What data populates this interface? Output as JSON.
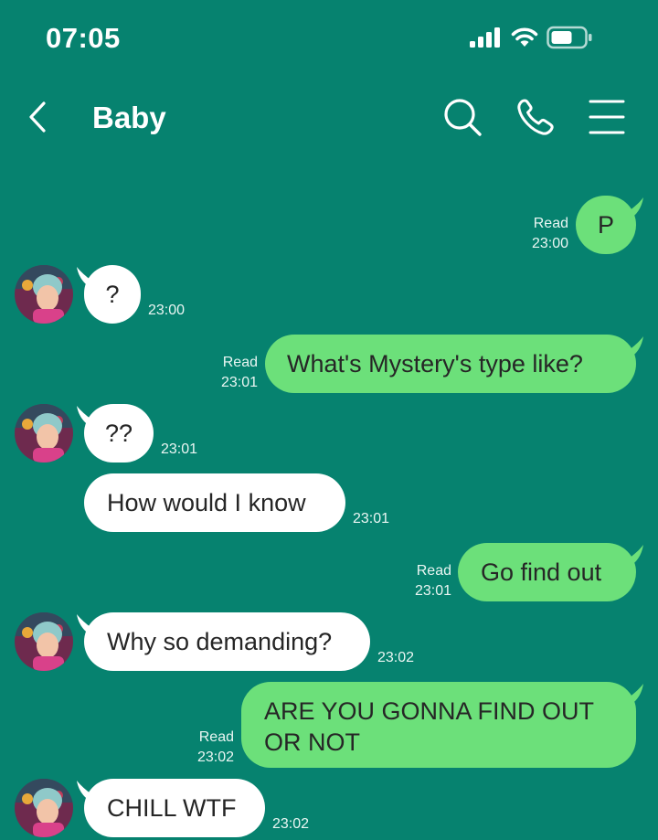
{
  "status_bar": {
    "time": "07:05",
    "signal_icon": "cellular-signal-icon",
    "wifi_icon": "wifi-icon",
    "battery_icon": "battery-icon"
  },
  "header": {
    "title": "Baby",
    "back_icon": "chevron-left-icon",
    "search_icon": "search-icon",
    "call_icon": "phone-icon",
    "menu_icon": "menu-icon"
  },
  "colors": {
    "background": "#06826F",
    "incoming_bubble": "#FFFFFF",
    "outgoing_bubble": "#6CE07A"
  },
  "messages": [
    {
      "direction": "out",
      "text": "P",
      "read": "Read",
      "time": "23:00"
    },
    {
      "direction": "in",
      "text": "?",
      "time": "23:00"
    },
    {
      "direction": "out",
      "text": "What's Mystery's type like?",
      "read": "Read",
      "time": "23:01"
    },
    {
      "direction": "in",
      "text": "??",
      "time": "23:01"
    },
    {
      "direction": "in",
      "text": "How would I know",
      "time": "23:01"
    },
    {
      "direction": "out",
      "text": "Go find out",
      "read": "Read",
      "time": "23:01"
    },
    {
      "direction": "in",
      "text": "Why so demanding?",
      "time": "23:02"
    },
    {
      "direction": "out",
      "text": "ARE YOU GONNA FIND OUT OR NOT",
      "read": "Read",
      "time": "23:02"
    },
    {
      "direction": "in",
      "text": "CHILL WTF",
      "time": "23:02"
    }
  ]
}
